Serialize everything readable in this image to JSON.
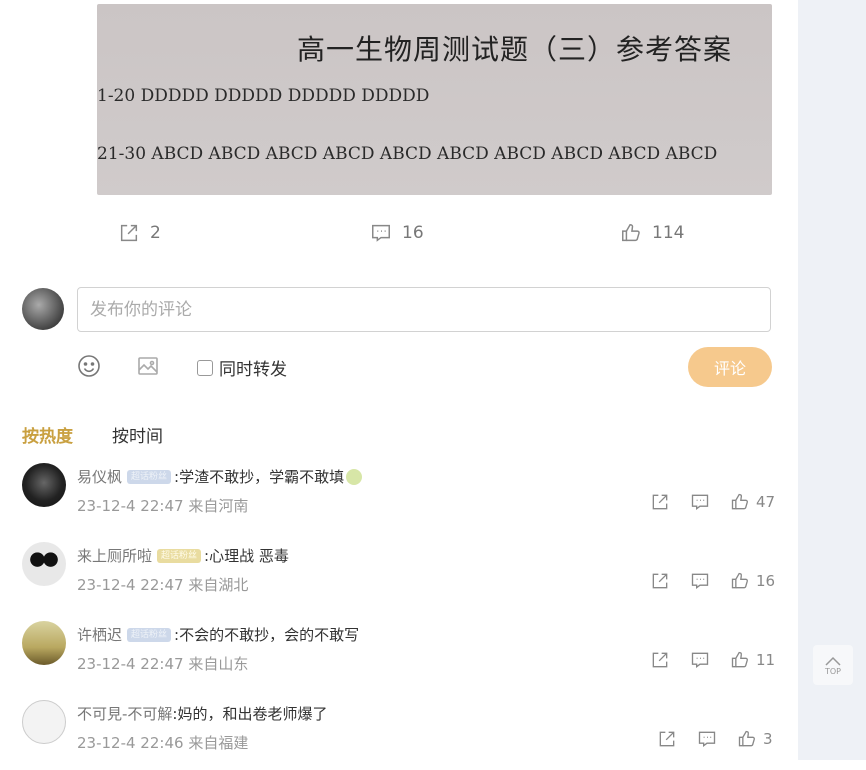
{
  "post": {
    "image": {
      "title": "高一生物周测试题（三）参考答案",
      "line1": "1-20 DDDDD DDDDD  DDDDD  DDDDD",
      "line2": "21-30 ABCD ABCD ABCD ABCD ABCD ABCD ABCD ABCD ABCD ABCD"
    },
    "actions": {
      "share_count": "2",
      "comment_count": "16",
      "like_count": "114"
    }
  },
  "composer": {
    "placeholder": "发布你的评论",
    "repost_label": "同时转发",
    "submit_label": "评论"
  },
  "sort": {
    "hot_label": "按热度",
    "time_label": "按时间"
  },
  "comments": [
    {
      "name": "易仪枫",
      "badge": "超话粉丝",
      "text": ":学渣不敢抄，学霸不敢填",
      "has_emoji": true,
      "time": "23-12-4 22:47",
      "location": "来自河南",
      "likes": "47"
    },
    {
      "name": "来上厕所啦",
      "badge": "超话粉丝",
      "text": ":心理战 恶毒",
      "has_emoji": false,
      "time": "23-12-4 22:47",
      "location": "来自湖北",
      "likes": "16"
    },
    {
      "name": "许栖迟",
      "badge": "超话粉丝",
      "text": ":不会的不敢抄，会的不敢写",
      "has_emoji": false,
      "time": "23-12-4 22:47",
      "location": "来自山东",
      "likes": "11"
    },
    {
      "name": "不可見-不可解",
      "badge": "",
      "text": ":妈的，和出卷老师爆了",
      "has_emoji": false,
      "time": "23-12-4 22:46",
      "location": "来自福建",
      "likes": "3"
    }
  ],
  "top_button": {
    "label": "TOP"
  },
  "colors": {
    "accent": "#f6c98d",
    "sort_active": "#c9a040"
  },
  "icons": [
    "share-icon",
    "comment-icon",
    "like-icon",
    "emoji-icon",
    "image-icon",
    "chevron-up-icon"
  ]
}
